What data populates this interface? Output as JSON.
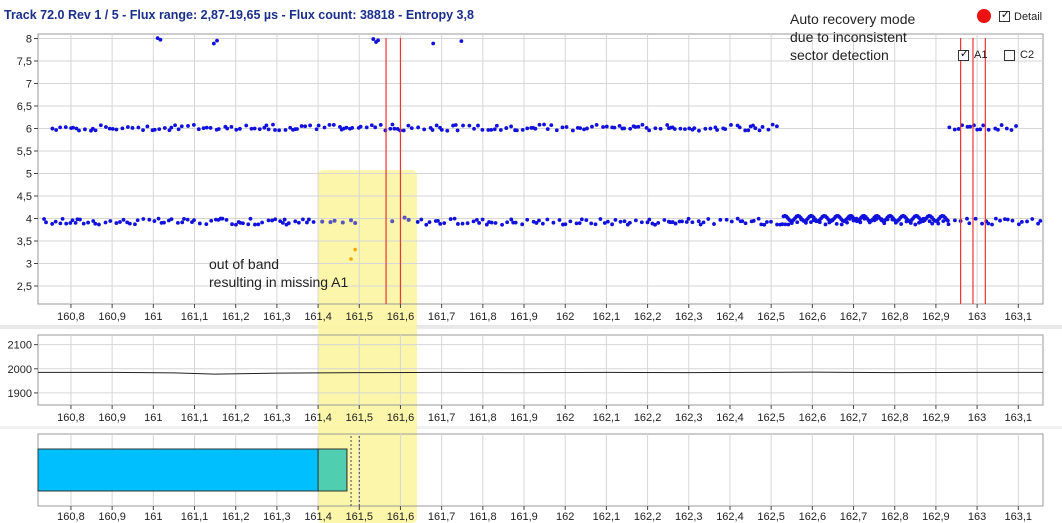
{
  "header": {
    "title": "Track 72.0 Rev 1 / 5 - Flux range: 2,87-19,65 µs - Flux count: 38818 - Entropy 3,8"
  },
  "controls": {
    "detail_label": "Detail",
    "detail_checked": true,
    "a1_label": "A1",
    "a1_checked": true,
    "c2_label": "C2",
    "c2_checked": false,
    "status_color": "#ee1111"
  },
  "annotations": {
    "top_right": "Auto recovery mode\ndue to inconsistent\nsector detection",
    "band": "out of band\nresulting in missing A1"
  },
  "chart_data": [
    {
      "type": "scatter",
      "xlim": [
        160.72,
        163.16
      ],
      "ylim": [
        2.1,
        8.1
      ],
      "y_ticks": [
        "8",
        "7,5",
        "7",
        "6,5",
        "6",
        "5,5",
        "5",
        "4,5",
        "4",
        "3,5",
        "3",
        "2,5"
      ],
      "y_tick_values": [
        8,
        7.5,
        7,
        6.5,
        6,
        5.5,
        5,
        4.5,
        4,
        3.5,
        3,
        2.5
      ],
      "x_ticks": [
        "160,8",
        "160,9",
        "161",
        "161,1",
        "161,2",
        "161,3",
        "161,4",
        "161,5",
        "161,6",
        "161,7",
        "161,8",
        "161,9",
        "162",
        "162,1",
        "162,2",
        "162,3",
        "162,4",
        "162,5",
        "162,6",
        "162,7",
        "162,8",
        "162,9",
        "163",
        "163,1"
      ],
      "x_tick_values": [
        160.8,
        160.9,
        161,
        161.1,
        161.2,
        161.3,
        161.4,
        161.5,
        161.6,
        161.7,
        161.8,
        161.9,
        162,
        162.1,
        162.2,
        162.3,
        162.4,
        162.5,
        162.6,
        162.7,
        162.8,
        162.9,
        163,
        163.1
      ],
      "grid": true,
      "bands": [
        {
          "label": "4",
          "y": 3.93,
          "ranges": [
            [
              160.72,
              163.16
            ]
          ]
        },
        {
          "label": "6",
          "y": 6.02,
          "ranges": [
            [
              160.74,
              162.52
            ],
            [
              162.92,
              163.1
            ]
          ]
        },
        {
          "label": "8",
          "y": 7.95,
          "ranges": [
            [
              160.75,
              161.75
            ]
          ]
        }
      ],
      "dense_segment": {
        "x": [
          162.53,
          162.93
        ],
        "y": 4.0
      },
      "highlighted_points": [
        {
          "x": 161.41,
          "y": 3.93
        },
        {
          "x": 161.43,
          "y": 3.92
        },
        {
          "x": 161.44,
          "y": 3.95
        },
        {
          "x": 161.46,
          "y": 3.91
        },
        {
          "x": 161.48,
          "y": 3.96
        },
        {
          "x": 161.49,
          "y": 3.9
        },
        {
          "x": 161.58,
          "y": 3.94
        },
        {
          "x": 161.61,
          "y": 4.02
        },
        {
          "x": 161.62,
          "y": 3.97
        }
      ],
      "out_of_band_points": [
        {
          "x": 161.49,
          "y": 3.31
        },
        {
          "x": 161.48,
          "y": 3.1
        }
      ],
      "marker_lines": [
        161.565,
        161.6,
        162.96,
        162.99,
        163.02
      ],
      "highlight_region": [
        161.4,
        161.64
      ]
    },
    {
      "type": "line",
      "xlim": [
        160.72,
        163.16
      ],
      "ylim": [
        1850,
        2140
      ],
      "y_ticks": [
        "2100",
        "2000",
        "1900"
      ],
      "y_tick_values": [
        2100,
        2000,
        1900
      ],
      "x_ticks": [
        "160,8",
        "160,9",
        "161",
        "161,1",
        "161,2",
        "161,3",
        "161,4",
        "161,5",
        "161,6",
        "161,7",
        "161,8",
        "161,9",
        "162",
        "162,1",
        "162,2",
        "162,3",
        "162,4",
        "162,5",
        "162,6",
        "162,7",
        "162,8",
        "162,9",
        "163",
        "163,1"
      ],
      "x_tick_values": [
        160.8,
        160.9,
        161,
        161.1,
        161.2,
        161.3,
        161.4,
        161.5,
        161.6,
        161.7,
        161.8,
        161.9,
        162,
        162.1,
        162.2,
        162.3,
        162.4,
        162.5,
        162.6,
        162.7,
        162.8,
        162.9,
        163,
        163.1
      ],
      "grid": true,
      "x": [
        160.72,
        160.9,
        161.05,
        161.15,
        161.3,
        161.5,
        161.7,
        161.9,
        162.1,
        162.3,
        162.45,
        162.6,
        162.8,
        163.0,
        163.16
      ],
      "values": [
        1985,
        1985,
        1983,
        1978,
        1982,
        1984,
        1985,
        1984,
        1985,
        1984,
        1985,
        1986,
        1984,
        1985,
        1985
      ]
    },
    {
      "type": "bar",
      "xlim": [
        160.72,
        163.16
      ],
      "x_ticks": [
        "160,8",
        "160,9",
        "161",
        "161,1",
        "161,2",
        "161,3",
        "161,4",
        "161,5",
        "161,6",
        "161,7",
        "161,8",
        "161,9",
        "162",
        "162,1",
        "162,2",
        "162,3",
        "162,4",
        "162,5",
        "162,6",
        "162,7",
        "162,8",
        "162,9",
        "163",
        "163,1"
      ],
      "x_tick_values": [
        160.8,
        160.9,
        161,
        161.1,
        161.2,
        161.3,
        161.4,
        161.5,
        161.6,
        161.7,
        161.8,
        161.9,
        162,
        162.1,
        162.2,
        162.3,
        162.4,
        162.5,
        162.6,
        162.7,
        162.8,
        162.9,
        163,
        163.1
      ],
      "grid": true,
      "segments": [
        {
          "start": 160.72,
          "end": 161.47,
          "color": "#00bfff"
        },
        {
          "start": 161.4,
          "end": 161.47,
          "color": "#4fcfb0"
        }
      ],
      "dashed_markers": [
        161.48,
        161.5
      ]
    }
  ],
  "colors": {
    "points": "#1111dd",
    "highlighted_points": "#5555bb",
    "out_of_band_points": "#f0a800",
    "marker_lines": "#ee3333",
    "highlight_region": "#fbf5a0",
    "grid": "#d6d6d6",
    "axis": "#444444"
  }
}
